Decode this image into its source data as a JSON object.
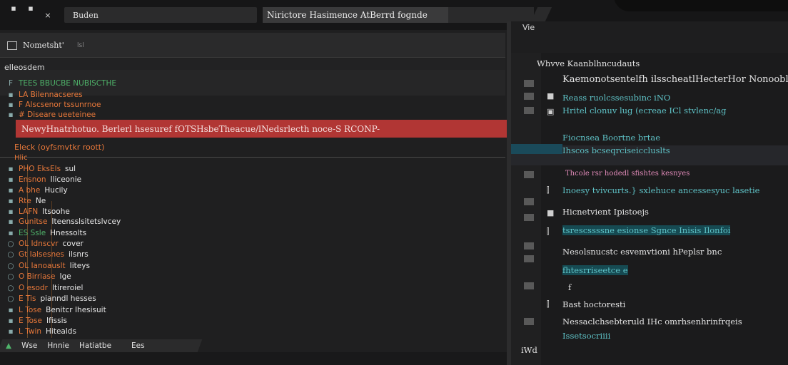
{
  "titlebar": {
    "tab_icons": [
      "▪",
      "▪",
      "×"
    ],
    "left_title": "Buden",
    "mid_title": "Nirictore Hasimence AtBerrd fognde"
  },
  "left_panel": {
    "header_title": "Nometsht'",
    "header_suffix": "lsl",
    "tree_header": "elleosdem",
    "tree_rows": [
      {
        "gut": "F",
        "tag": "TEES BBUCBE NUBISCTHE",
        "color": "green",
        "text": ""
      },
      {
        "gut": "",
        "tag": "LA Bilennacseres",
        "color": "orange",
        "text": ""
      },
      {
        "gut": "",
        "tag": "F Alscsenor tssunrnoe",
        "color": "orange",
        "text": ""
      },
      {
        "gut": "",
        "tag": "# Diseare ueeteinee",
        "color": "orange",
        "text": ""
      }
    ],
    "highlight_row": "NewyHnatrhotuo. Berlerl hsesuref fOTSHsbeTheacue/lNedsrlecth noce-S RCONP-",
    "section_label": "Eleck (oyfsmvtkr roott)",
    "section_sub": "Hlic",
    "list_rows": [
      {
        "gut": "",
        "tag": "PHO EksEls",
        "text": "sul"
      },
      {
        "gut": "",
        "tag": "Ensnon",
        "text": "Iliceonie"
      },
      {
        "gut": "",
        "tag": "A bhe",
        "text": "Hucily"
      },
      {
        "gut": "",
        "tag": "Rte",
        "text": "Ne"
      },
      {
        "gut": "",
        "tag": "LAFN",
        "text": "Itsoohe"
      },
      {
        "gut": "",
        "tag": "Gunitse",
        "text": "Iteensslsitetslvcey"
      },
      {
        "gut": "",
        "tag": "ES Ssle",
        "text": "Hnessolts"
      },
      {
        "gut": "",
        "tag": "OL Idnscvr",
        "text": "cover"
      },
      {
        "gut": "",
        "tag": "Gt Ialsesnes",
        "text": "ilsnrs"
      },
      {
        "gut": "",
        "tag": "OL Ianoauslt",
        "text": "Iiteys"
      },
      {
        "gut": "",
        "tag": "O Birriase",
        "text": "Ige"
      },
      {
        "gut": "",
        "tag": "O esodr",
        "text": "Itireroiel"
      },
      {
        "gut": "",
        "tag": "E Tis",
        "text": "pianndl hesses"
      },
      {
        "gut": "",
        "tag": "L Tose",
        "text": "Benitcr Ihesisuit"
      },
      {
        "gut": "",
        "tag": "E Tose",
        "text": "Ifissis"
      },
      {
        "gut": "",
        "tag": "L Twin",
        "text": "Hitealds"
      }
    ],
    "status_items": [
      "Wse",
      "Hnnie",
      "Hatiatbe",
      "Ees"
    ]
  },
  "right_panel": {
    "top_label": "Vie",
    "rows": [
      {
        "text": "Whvve Kaanblhncudauts",
        "cls": "gray"
      },
      {
        "text": "Kaemonotsentelfh ilsscheatlHecterHor Nonoobleca",
        "cls": ""
      },
      {
        "text": "Reass ruolcssesubinc iNO",
        "cls": "teal"
      },
      {
        "text": "Hritel clonuv lug (ecreae ICl stvlenc/ag",
        "cls": "teal"
      },
      {
        "text": "Fiocnsea Boortne brtae",
        "cls": "teal"
      },
      {
        "text": "Ihscos bcseqrciseiccluslts",
        "cls": "teal"
      },
      {
        "text": "Thcole rsr hodedl sfishtes kesnyes",
        "cls": "pink"
      },
      {
        "text": "Inoesy tvivcurts.} sxlehuce ancessesyuc lasetie",
        "cls": "teal"
      },
      {
        "text": "Hicnetvient Ipistoejs",
        "cls": ""
      },
      {
        "text": "tsrescssssne esionse Sgnce Inisis Ilonfoi",
        "cls": "teal"
      },
      {
        "text": "Nesolsnucstc esvemvtioni hPeplsr bnc",
        "cls": ""
      },
      {
        "text": "fhtesrriseetce e",
        "cls": "teal"
      },
      {
        "text": "f",
        "cls": ""
      },
      {
        "text": "Bast hoctoresti",
        "cls": ""
      },
      {
        "text": "Nessaclchsebteruld IHc omrhsenhrinfrqeis",
        "cls": ""
      },
      {
        "text": "Issetsocriiii",
        "cls": "teal"
      },
      {
        "text": "iWd",
        "cls": ""
      }
    ]
  }
}
